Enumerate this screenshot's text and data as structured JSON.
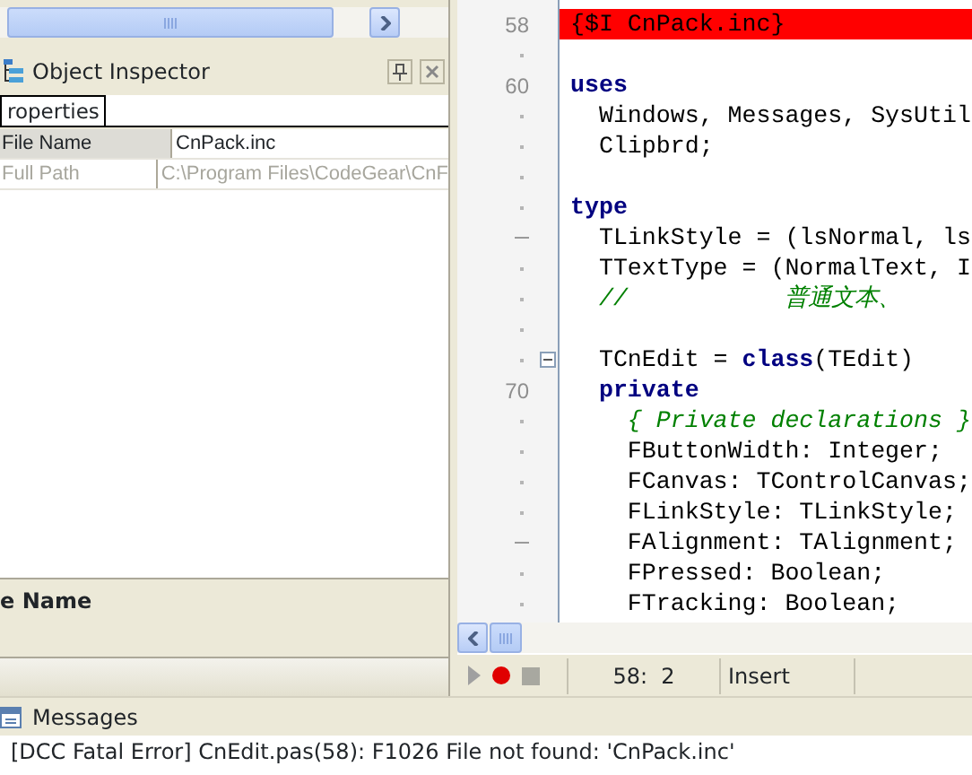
{
  "object_inspector": {
    "title": "Object Inspector",
    "tabs": [
      {
        "label": "roperties",
        "selected": true
      }
    ],
    "properties": [
      {
        "name": "File Name",
        "value": "CnPack.inc",
        "selected": true,
        "disabled": false
      },
      {
        "name": "Full Path",
        "value": "C:\\Program Files\\CodeGear\\CnF",
        "selected": false,
        "disabled": true
      }
    ],
    "description_title": "e Name"
  },
  "editor": {
    "lines": [
      {
        "kind": "numbered",
        "number": "58",
        "highlighted": true,
        "segments": [
          {
            "kind": "plain",
            "text": "{$I CnPack.inc}"
          }
        ]
      },
      {
        "kind": "dot"
      },
      {
        "kind": "numbered",
        "number": "60",
        "segments": [
          {
            "kind": "keyword",
            "text": "uses"
          }
        ]
      },
      {
        "kind": "dot",
        "segments": [
          {
            "kind": "plain",
            "text": "  Windows, Messages, SysUtil"
          }
        ]
      },
      {
        "kind": "dot",
        "segments": [
          {
            "kind": "plain",
            "text": "  Clipbrd;"
          }
        ]
      },
      {
        "kind": "dot"
      },
      {
        "kind": "dot",
        "segments": [
          {
            "kind": "keyword",
            "text": "type"
          }
        ]
      },
      {
        "kind": "dash",
        "segments": [
          {
            "kind": "plain",
            "text": "  TLinkStyle = (lsNormal, ls"
          }
        ]
      },
      {
        "kind": "dot",
        "segments": [
          {
            "kind": "plain",
            "text": "  TTextType = (NormalText, I"
          }
        ]
      },
      {
        "kind": "dot",
        "segments": [
          {
            "kind": "comment",
            "text": "  //           普通文本、"
          }
        ]
      },
      {
        "kind": "dot"
      },
      {
        "kind": "dot",
        "fold": true,
        "segments": [
          {
            "kind": "plain",
            "text": "  TCnEdit = "
          },
          {
            "kind": "keyword",
            "text": "class"
          },
          {
            "kind": "plain",
            "text": "(TEdit)"
          }
        ]
      },
      {
        "kind": "numbered",
        "number": "70",
        "segments": [
          {
            "kind": "keyword",
            "text": "  private"
          }
        ]
      },
      {
        "kind": "dot",
        "segments": [
          {
            "kind": "comment",
            "text": "    { Private declarations }"
          }
        ]
      },
      {
        "kind": "dot",
        "segments": [
          {
            "kind": "plain",
            "text": "    FButtonWidth: Integer;"
          }
        ]
      },
      {
        "kind": "dot",
        "segments": [
          {
            "kind": "plain",
            "text": "    FCanvas: TControlCanvas;"
          }
        ]
      },
      {
        "kind": "dot",
        "segments": [
          {
            "kind": "plain",
            "text": "    FLinkStyle: TLinkStyle;"
          }
        ]
      },
      {
        "kind": "dash",
        "segments": [
          {
            "kind": "plain",
            "text": "    FAlignment: TAlignment;"
          }
        ]
      },
      {
        "kind": "dot",
        "segments": [
          {
            "kind": "plain",
            "text": "    FPressed: Boolean;"
          }
        ]
      },
      {
        "kind": "dot",
        "segments": [
          {
            "kind": "plain",
            "text": "    FTracking: Boolean;"
          }
        ]
      }
    ],
    "status": {
      "position": "58:  2",
      "mode": "Insert"
    }
  },
  "messages": {
    "title": "Messages",
    "items": [
      "[DCC Fatal Error] CnEdit.pas(58): F1026 File not found: 'CnPack.inc'"
    ]
  }
}
